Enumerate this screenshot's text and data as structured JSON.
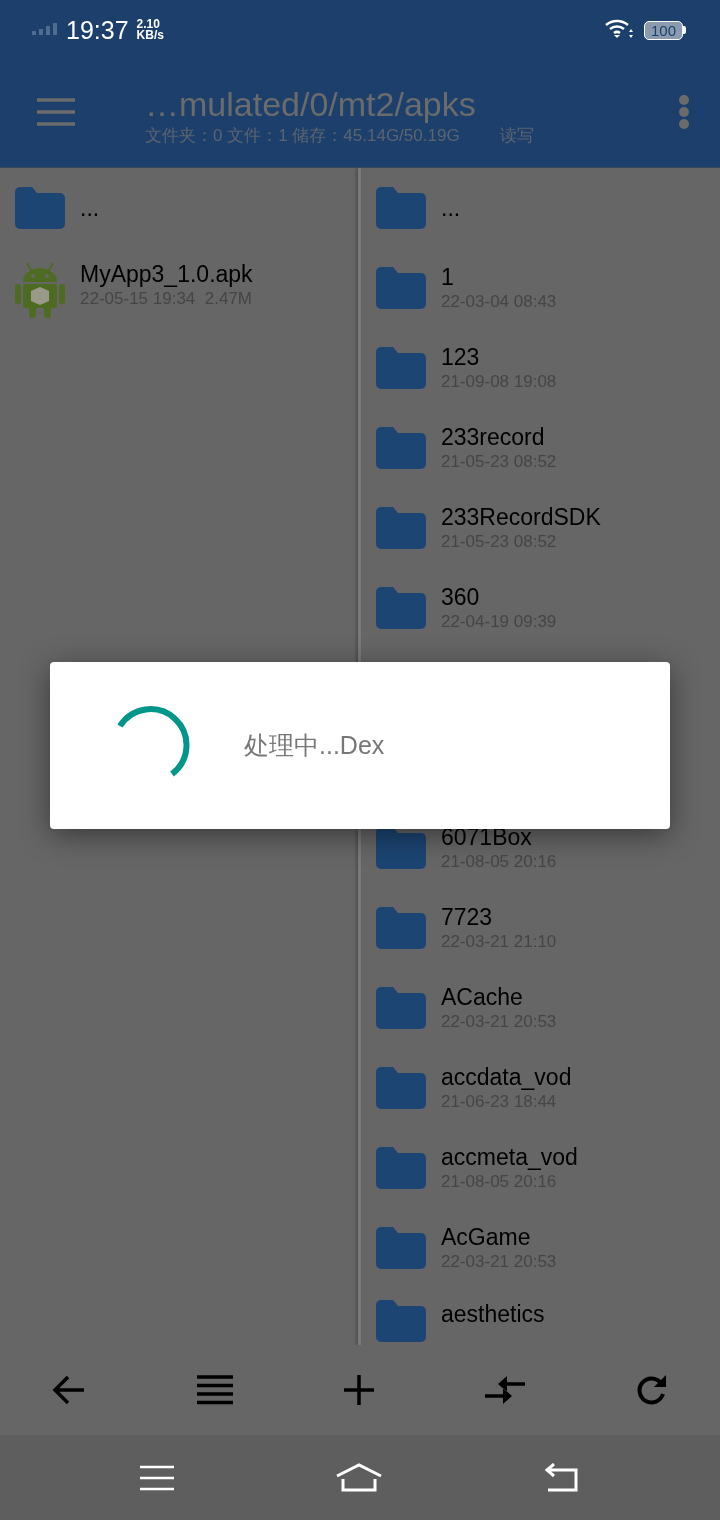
{
  "status_bar": {
    "time": "19:37",
    "speed_value": "2.10",
    "speed_unit": "KB/s",
    "battery": "100"
  },
  "header": {
    "path": "…mulated/0/mt2/apks",
    "info": "文件夹：0 文件：1 储存：45.14G/50.19G",
    "mode": "读写"
  },
  "left_pane": {
    "items": [
      {
        "kind": "folder",
        "name": "..."
      },
      {
        "kind": "apk",
        "name": "MyApp3_1.0.apk",
        "meta": "22-05-15 19:34  2.47M"
      }
    ]
  },
  "right_pane": {
    "items": [
      {
        "kind": "folder",
        "name": "..."
      },
      {
        "kind": "folder",
        "name": "1",
        "meta": "22-03-04 08:43"
      },
      {
        "kind": "folder",
        "name": "123",
        "meta": "21-09-08 19:08"
      },
      {
        "kind": "folder",
        "name": "233record",
        "meta": "21-05-23 08:52"
      },
      {
        "kind": "folder",
        "name": "233RecordSDK",
        "meta": "21-05-23 08:52"
      },
      {
        "kind": "folder",
        "name": "360",
        "meta": "22-04-19 09:39"
      }
    ],
    "items_below_dialog": [
      {
        "kind": "folder",
        "name": "6071Box",
        "meta": "21-08-05 20:16"
      },
      {
        "kind": "folder",
        "name": "7723",
        "meta": "22-03-21 21:10"
      },
      {
        "kind": "folder",
        "name": "ACache",
        "meta": "22-03-21 20:53"
      },
      {
        "kind": "folder",
        "name": "accdata_vod",
        "meta": "21-06-23 18:44"
      },
      {
        "kind": "folder",
        "name": "accmeta_vod",
        "meta": "21-08-05 20:16"
      },
      {
        "kind": "folder",
        "name": "AcGame",
        "meta": "22-03-21 20:53"
      },
      {
        "kind": "folder",
        "name": "aesthetics"
      }
    ]
  },
  "dialog": {
    "message": "处理中...Dex"
  },
  "toolbar": [
    {
      "kind": "back"
    },
    {
      "kind": "list"
    },
    {
      "kind": "add"
    },
    {
      "kind": "swap"
    },
    {
      "kind": "refresh"
    }
  ],
  "nav_bar": [
    {
      "kind": "menu"
    },
    {
      "kind": "home"
    },
    {
      "kind": "return"
    }
  ]
}
